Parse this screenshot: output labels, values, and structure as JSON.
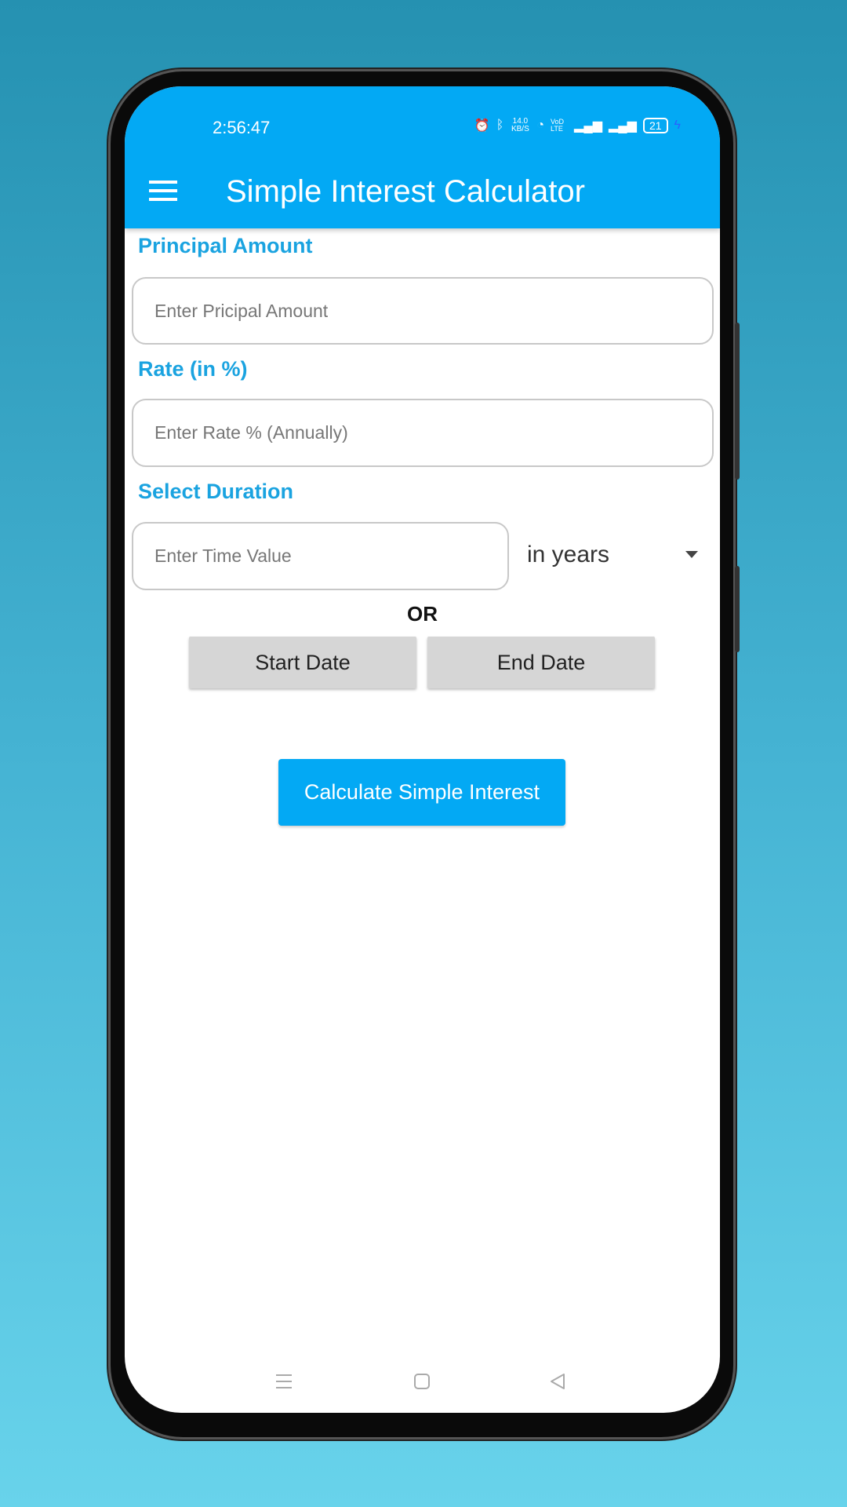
{
  "status_bar": {
    "time": "2:56:47",
    "net_speed": "14.0 KB/S",
    "network": "VoD LTE",
    "battery": "21",
    "icons": [
      "alarm-icon",
      "bluetooth-icon",
      "wifi-icon",
      "signal-icon",
      "signal-icon",
      "battery-icon",
      "charging-icon"
    ]
  },
  "app_bar": {
    "title": "Simple Interest Calculator",
    "menu_icon": "hamburger-icon"
  },
  "form": {
    "principal_label": "Principal Amount",
    "principal_placeholder": "Enter Pricipal Amount",
    "rate_label": "Rate (in %)",
    "rate_placeholder": "Enter Rate % (Annually)",
    "duration_label": "Select Duration",
    "time_placeholder": "Enter Time Value",
    "unit_selected": "in years",
    "or_label": "OR",
    "start_date": "Start Date",
    "end_date": "End Date",
    "calculate": "Calculate Simple Interest"
  },
  "colors": {
    "accent": "#03a9f4",
    "label": "#1aa3e0"
  }
}
